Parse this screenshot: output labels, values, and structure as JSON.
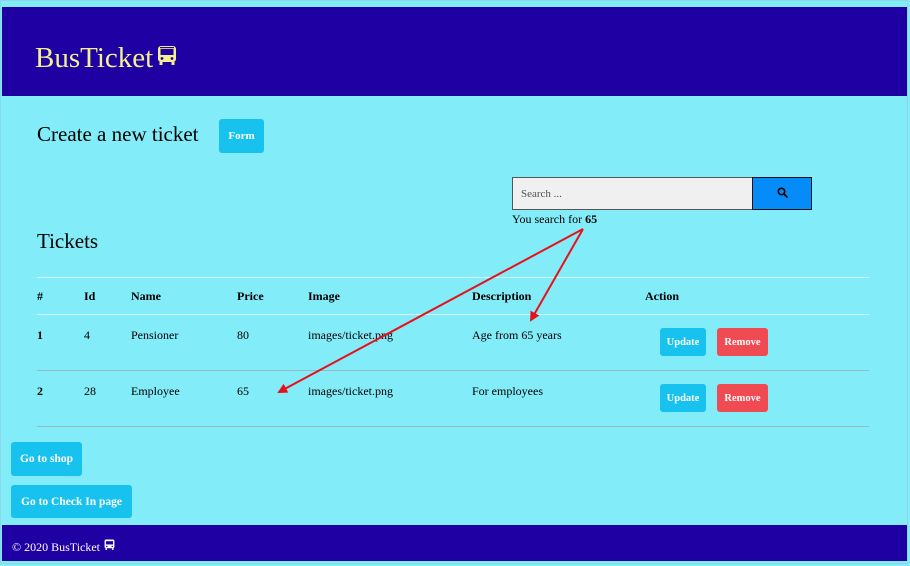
{
  "app": {
    "brand": "BusTicket",
    "brand_color": "#f3f18f",
    "nav_color": "#1f00a3",
    "bg_color": "#82ecf8"
  },
  "create": {
    "title": "Create a new ticket",
    "form_button": "Form"
  },
  "search": {
    "placeholder": "Search ...",
    "button_icon": "search-icon",
    "result_prefix": "You search for",
    "result_term": "65"
  },
  "tickets": {
    "title": "Tickets",
    "columns": [
      "#",
      "Id",
      "Name",
      "Price",
      "Image",
      "Description",
      "Action"
    ],
    "rows": [
      {
        "index": "1",
        "id": "4",
        "name": "Pensioner",
        "price": "80",
        "image": "images/ticket.png",
        "description": "Age from 65 years"
      },
      {
        "index": "2",
        "id": "28",
        "name": "Employee",
        "price": "65",
        "image": "images/ticket.png",
        "description": "For employees"
      }
    ],
    "update_label": "Update",
    "remove_label": "Remove"
  },
  "links": {
    "shop": "Go to shop",
    "checkin": "Go to Check In page"
  },
  "footer": {
    "text": "© 2020 BusTicket"
  },
  "annotation": {
    "arrow_color": "#e8101a"
  }
}
